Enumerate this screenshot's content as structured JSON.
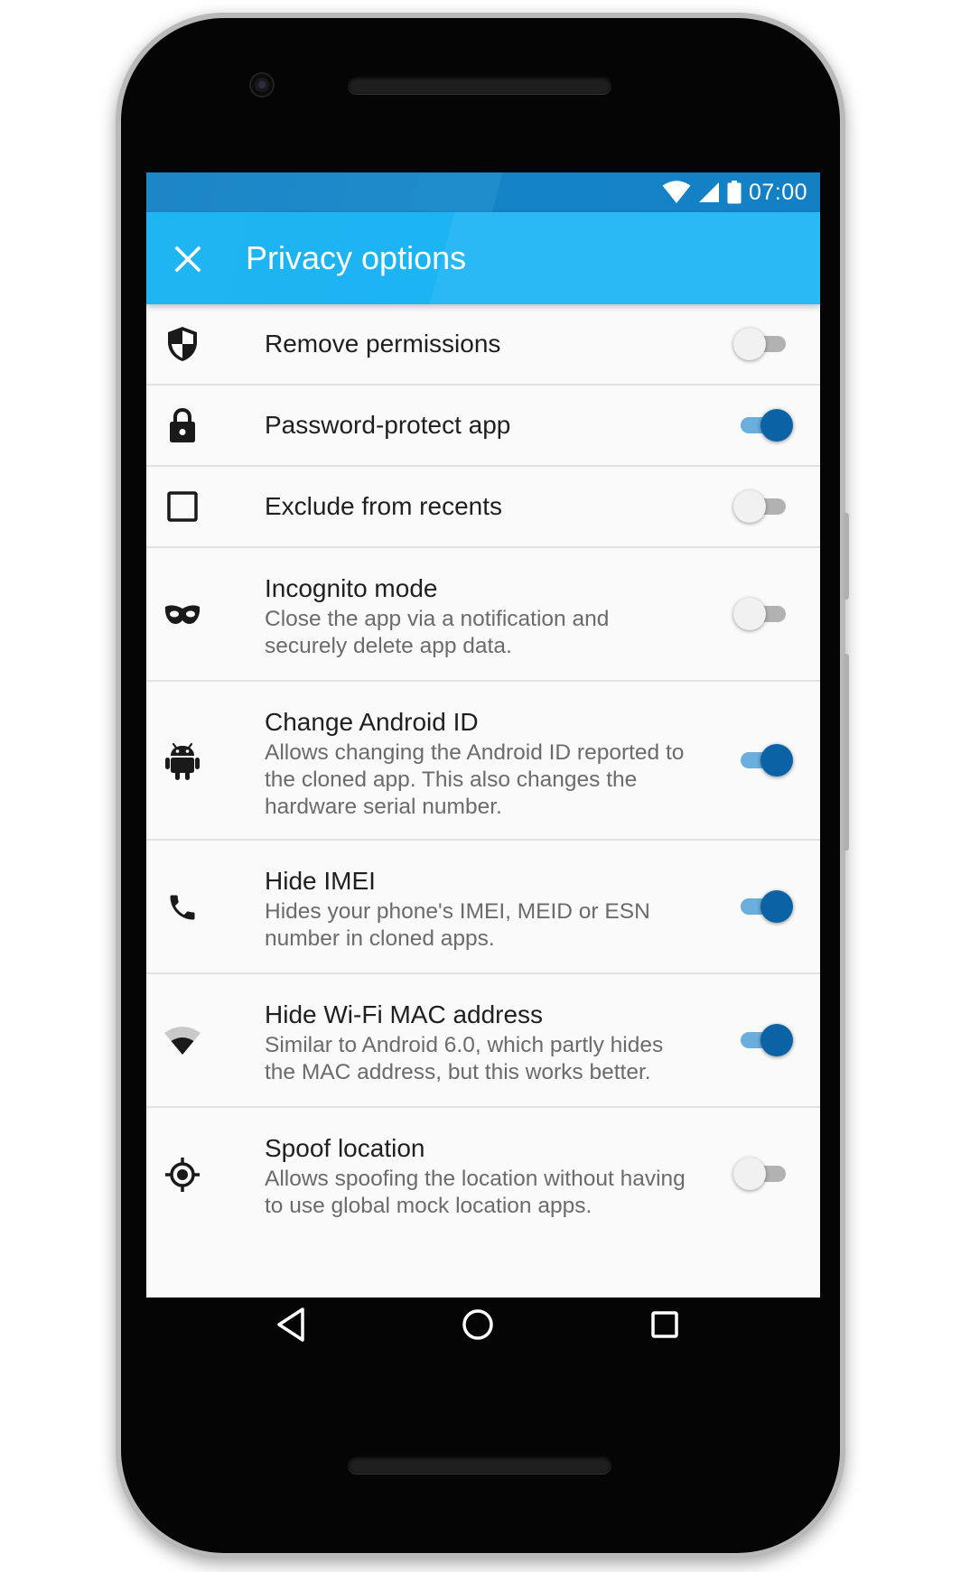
{
  "status_bar": {
    "time": "07:00",
    "icons": [
      "wifi-icon",
      "signal-icon",
      "battery-icon"
    ]
  },
  "app_bar": {
    "title": "Privacy options",
    "close_icon": "close-icon"
  },
  "settings": [
    {
      "icon": "shield-icon",
      "title": "Remove permissions",
      "description": "",
      "enabled": false
    },
    {
      "icon": "lock-icon",
      "title": "Password-protect app",
      "description": "",
      "enabled": true
    },
    {
      "icon": "checkbox-outline-icon",
      "title": "Exclude from recents",
      "description": "",
      "enabled": false
    },
    {
      "icon": "mask-icon",
      "title": "Incognito mode",
      "description": "Close the app via a notification and securely delete app data.",
      "enabled": false
    },
    {
      "icon": "android-icon",
      "title": "Change Android ID",
      "description": "Allows changing the Android ID reported to the cloned app. This also changes the hardware serial number.",
      "enabled": true
    },
    {
      "icon": "phone-icon",
      "title": "Hide IMEI",
      "description": "Hides your phone's IMEI, MEID or ESN number in cloned apps.",
      "enabled": true
    },
    {
      "icon": "wifi-icon",
      "title": "Hide Wi-Fi MAC address",
      "description": "Similar to Android 6.0, which partly hides the MAC address, but this works better.",
      "enabled": true
    },
    {
      "icon": "location-target-icon",
      "title": "Spoof location",
      "description": "Allows spoofing the location without having to use global mock location apps.",
      "enabled": false
    }
  ],
  "nav_bar": {
    "buttons": [
      "back-icon",
      "home-icon",
      "recents-icon"
    ]
  },
  "colors": {
    "status_bar": "#1f8ccc",
    "app_bar": "#1db4f3",
    "switch_on_thumb": "#0b63a6",
    "switch_on_track": "#6aaedd",
    "switch_off_thumb": "#f1f1f1",
    "switch_off_track": "#b2b2b2"
  }
}
